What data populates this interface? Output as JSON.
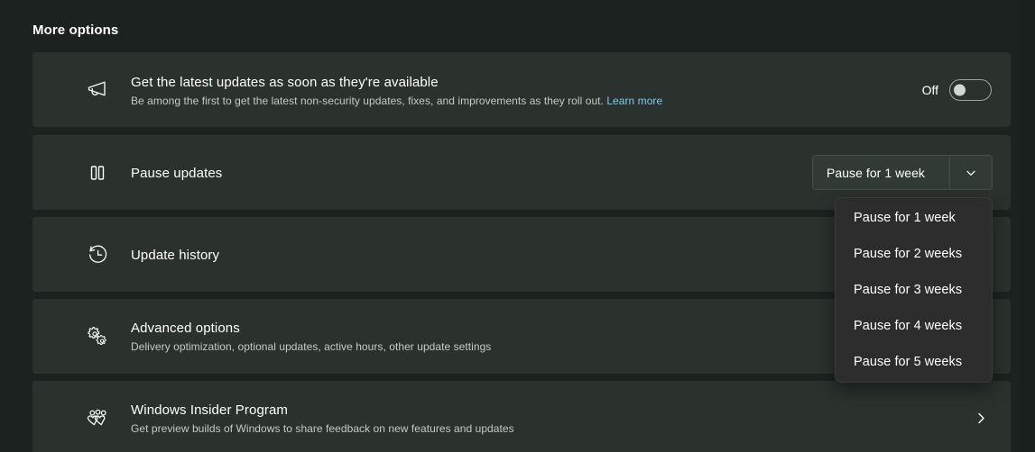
{
  "page": {
    "title": "More options",
    "background_color": "#1c2220",
    "card_color": "#2b322e",
    "accent_link_color": "#76cdf2"
  },
  "cards": [
    {
      "icon": "megaphone-icon",
      "title": "Get the latest updates as soon as they're available",
      "subtitle": "Be among the first to get the latest non-security updates, fixes, and improvements as they roll out.",
      "link_label": "Learn more",
      "toggle": {
        "label": "Off",
        "state": "off"
      }
    },
    {
      "icon": "pause-icon",
      "title": "Pause updates",
      "subtitle": "",
      "dropdown": {
        "selected": "Pause for 1 week",
        "expanded": true,
        "options": [
          "Pause for 1 week",
          "Pause for 2 weeks",
          "Pause for 3 weeks",
          "Pause for 4 weeks",
          "Pause for 5 weeks"
        ]
      }
    },
    {
      "icon": "history-icon",
      "title": "Update history",
      "subtitle": ""
    },
    {
      "icon": "gears-icon",
      "title": "Advanced options",
      "subtitle": "Delivery optimization, optional updates, active hours, other update settings"
    },
    {
      "icon": "insider-people-icon",
      "title": "Windows Insider Program",
      "subtitle": "Get preview builds of Windows to share feedback on new features and updates",
      "chevron": "chevron-right-icon"
    }
  ]
}
